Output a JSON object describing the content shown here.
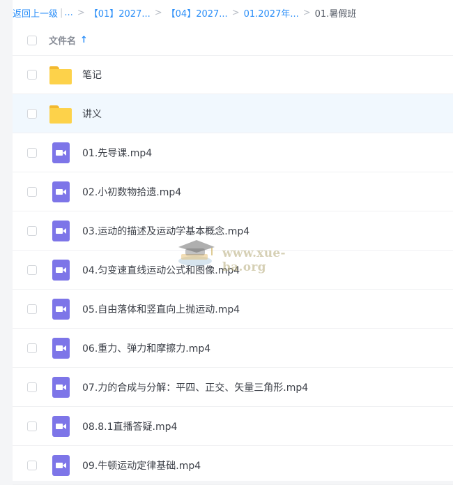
{
  "breadcrumb": {
    "back": "返回上一级",
    "bar": "|",
    "ellipsis": "...",
    "separator": ">",
    "items": [
      "【01】2027...",
      "【04】2027...",
      "01.2027年..."
    ],
    "current": "01.暑假班"
  },
  "header": {
    "column": "文件名",
    "sort_icon": "arrow-up-icon",
    "sort_glyph": "↑"
  },
  "files": [
    {
      "name": "笔记",
      "type": "folder"
    },
    {
      "name": "讲义",
      "type": "folder",
      "selected": true
    },
    {
      "name": "01.先导课.mp4",
      "type": "video"
    },
    {
      "name": "02.小初数物拾遗.mp4",
      "type": "video"
    },
    {
      "name": "03.运动的描述及运动学基本概念.mp4",
      "type": "video"
    },
    {
      "name": "04.匀变速直线运动公式和图像.mp4",
      "type": "video"
    },
    {
      "name": "05.自由落体和竖直向上抛运动.mp4",
      "type": "video"
    },
    {
      "name": "06.重力、弹力和摩擦力.mp4",
      "type": "video"
    },
    {
      "name": "07.力的合成与分解：平四、正交、矢量三角形.mp4",
      "type": "video"
    },
    {
      "name": "08.8.1直播答疑.mp4",
      "type": "video"
    },
    {
      "name": "09.牛顿运动定律基础.mp4",
      "type": "video"
    }
  ],
  "watermark": {
    "text": "www.xue-ba.org",
    "icon": "graduation-cap-icon"
  },
  "colors": {
    "link": "#2a8ef8",
    "folder": "#fdd24a",
    "video": "#7d75e8",
    "selected_row": "#f1f8fe"
  }
}
